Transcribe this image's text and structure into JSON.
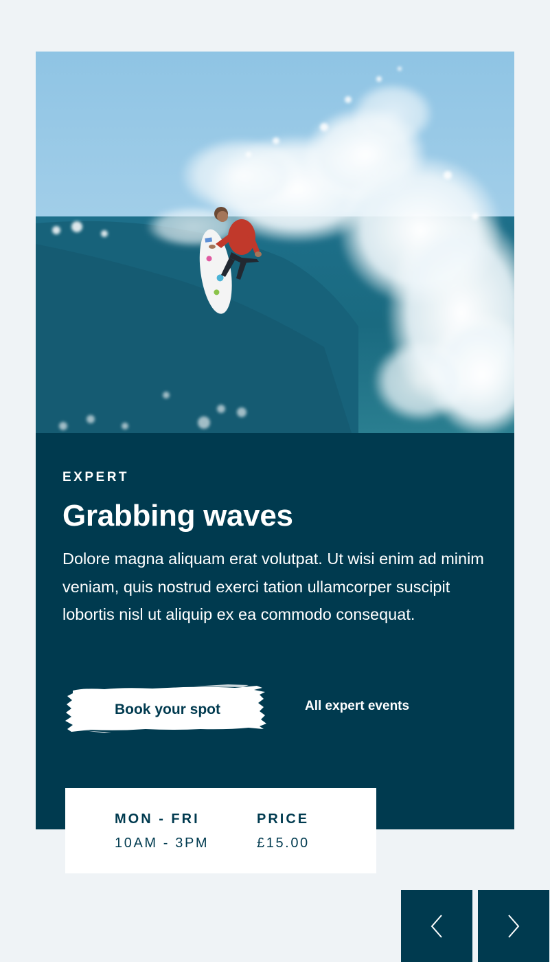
{
  "event": {
    "level": "EXPERT",
    "title": "Grabbing waves",
    "description": "Dolore magna aliquam erat volutpat. Ut wisi enim ad minim veniam, quis nostrud exerci tation ullamcorper suscipit lobortis nisl ut aliquip ex ea commodo consequat.",
    "book_button_label": "Book your spot",
    "all_events_link": "All expert events"
  },
  "schedule": {
    "days_label": "MON - FRI",
    "hours": "10AM - 3PM",
    "price_label": "PRICE",
    "price": "£15.00"
  },
  "colors": {
    "navy": "#003a4f",
    "background": "#eff3f6",
    "white": "#ffffff"
  },
  "icons": {
    "prev": "chevron-left-icon",
    "next": "chevron-right-icon"
  }
}
